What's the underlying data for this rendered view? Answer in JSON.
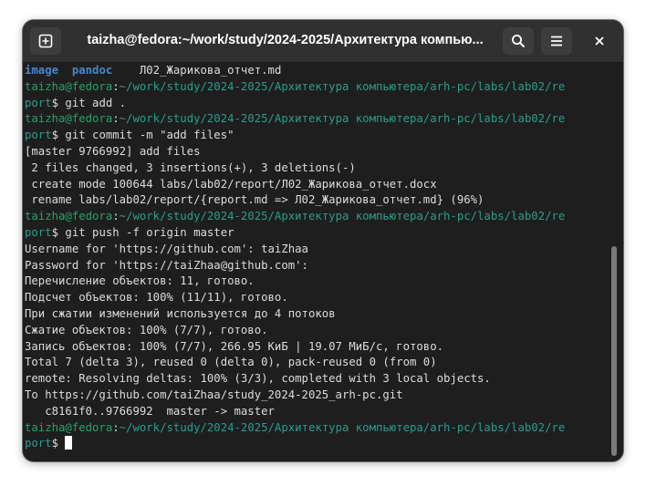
{
  "window": {
    "title": "taizha@fedora:~/work/study/2024-2025/Архитектура компью..."
  },
  "headerbar": {
    "new_tab_icon": "new-tab-icon",
    "search_icon": "search-icon",
    "menu_icon": "hamburger-menu-icon",
    "close_icon": "close-icon"
  },
  "colors": {
    "background": "#1e1e1e",
    "headerbar": "#303030",
    "prompt_green": "#26a269",
    "dir_blue": "#4a86c8",
    "text": "#dcdcdc"
  },
  "terminal": {
    "lines": [
      {
        "segments": [
          {
            "t": "image",
            "c": "blue"
          },
          {
            "t": "  ",
            "c": "white"
          },
          {
            "t": "pandoc",
            "c": "blue"
          },
          {
            "t": "    Л02_Жарикова_отчет.md",
            "c": "white"
          }
        ]
      },
      {
        "segments": [
          {
            "t": "taizha@fedora",
            "c": "green"
          },
          {
            "t": ":",
            "c": "white"
          },
          {
            "t": "~/work/study/2024-2025/Архитектура компьютера/arh-pc/labs/lab02/re",
            "c": "teal"
          }
        ]
      },
      {
        "segments": [
          {
            "t": "port",
            "c": "teal"
          },
          {
            "t": "$ git add .",
            "c": "white"
          }
        ]
      },
      {
        "segments": [
          {
            "t": "taizha@fedora",
            "c": "green"
          },
          {
            "t": ":",
            "c": "white"
          },
          {
            "t": "~/work/study/2024-2025/Архитектура компьютера/arh-pc/labs/lab02/re",
            "c": "teal"
          }
        ]
      },
      {
        "segments": [
          {
            "t": "port",
            "c": "teal"
          },
          {
            "t": "$ git commit -m \"add files\"",
            "c": "white"
          }
        ]
      },
      {
        "segments": [
          {
            "t": "[master 9766992] add files",
            "c": "white"
          }
        ]
      },
      {
        "segments": [
          {
            "t": " 2 files changed, 3 insertions(+), 3 deletions(-)",
            "c": "white"
          }
        ]
      },
      {
        "segments": [
          {
            "t": " create mode 100644 labs/lab02/report/Л02_Жарикова_отчет.docx",
            "c": "white"
          }
        ]
      },
      {
        "segments": [
          {
            "t": " rename labs/lab02/report/{report.md => Л02_Жарикова_отчет.md} (96%)",
            "c": "white"
          }
        ]
      },
      {
        "segments": [
          {
            "t": "taizha@fedora",
            "c": "green"
          },
          {
            "t": ":",
            "c": "white"
          },
          {
            "t": "~/work/study/2024-2025/Архитектура компьютера/arh-pc/labs/lab02/re",
            "c": "teal"
          }
        ]
      },
      {
        "segments": [
          {
            "t": "port",
            "c": "teal"
          },
          {
            "t": "$ git push -f origin master",
            "c": "white"
          }
        ]
      },
      {
        "segments": [
          {
            "t": "Username for 'https://github.com': taiZhaa",
            "c": "white"
          }
        ]
      },
      {
        "segments": [
          {
            "t": "Password for 'https://taiZhaa@github.com':",
            "c": "white"
          }
        ]
      },
      {
        "segments": [
          {
            "t": "Перечисление объектов: 11, готово.",
            "c": "white"
          }
        ]
      },
      {
        "segments": [
          {
            "t": "Подсчет объектов: 100% (11/11), готово.",
            "c": "white"
          }
        ]
      },
      {
        "segments": [
          {
            "t": "При сжатии изменений используется до 4 потоков",
            "c": "white"
          }
        ]
      },
      {
        "segments": [
          {
            "t": "Сжатие объектов: 100% (7/7), готово.",
            "c": "white"
          }
        ]
      },
      {
        "segments": [
          {
            "t": "Запись объектов: 100% (7/7), 266.95 КиБ | 19.07 МиБ/с, готово.",
            "c": "white"
          }
        ]
      },
      {
        "segments": [
          {
            "t": "Total 7 (delta 3), reused 0 (delta 0), pack-reused 0 (from 0)",
            "c": "white"
          }
        ]
      },
      {
        "segments": [
          {
            "t": "remote: Resolving deltas: 100% (3/3), completed with 3 local objects.",
            "c": "white"
          }
        ]
      },
      {
        "segments": [
          {
            "t": "To https://github.com/taiZhaa/study_2024-2025_arh-pc.git",
            "c": "white"
          }
        ]
      },
      {
        "segments": [
          {
            "t": "   c8161f0..9766992  master -> master",
            "c": "white"
          }
        ]
      },
      {
        "segments": [
          {
            "t": "taizha@fedora",
            "c": "green"
          },
          {
            "t": ":",
            "c": "white"
          },
          {
            "t": "~/work/study/2024-2025/Архитектура компьютера/arh-pc/labs/lab02/re",
            "c": "teal"
          }
        ]
      },
      {
        "segments": [
          {
            "t": "port",
            "c": "teal"
          },
          {
            "t": "$ ",
            "c": "white"
          }
        ],
        "cursor": true
      }
    ]
  }
}
